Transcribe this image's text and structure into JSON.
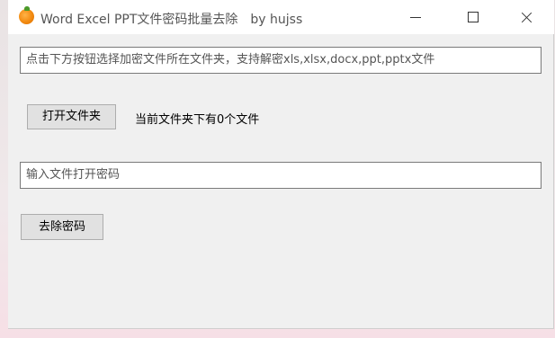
{
  "window": {
    "title": "Word Excel PPT文件密码批量去除",
    "author": "by hujss",
    "app_icon": "orange-icon"
  },
  "path_input": {
    "value": "点击下方按钮选择加密文件所在文件夹，支持解密xls,xlsx,docx,ppt,pptx文件"
  },
  "open_folder_button": {
    "label": "打开文件夹"
  },
  "status": {
    "text": "当前文件夹下有0个文件"
  },
  "password_input": {
    "value": "输入文件打开密码"
  },
  "remove_password_button": {
    "label": "去除密码"
  }
}
